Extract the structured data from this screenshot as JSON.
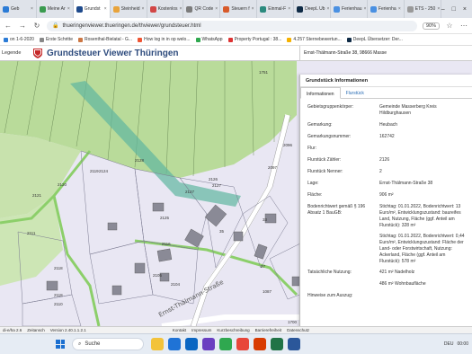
{
  "browser": {
    "tabs": [
      {
        "label": "Geb",
        "color": "#2b7bd6"
      },
      {
        "label": "Meine Ar",
        "color": "#3a9b4f"
      },
      {
        "label": "Grundst",
        "color": "#1e4a8c",
        "active": true
      },
      {
        "label": "Steinheid",
        "color": "#e8a33b"
      },
      {
        "label": "Kostenlos",
        "color": "#d24646"
      },
      {
        "label": "QR Code",
        "color": "#7c7c7c"
      },
      {
        "label": "Steuern f",
        "color": "#d85a2a"
      },
      {
        "label": "Einmal-F",
        "color": "#2b8a7e"
      },
      {
        "label": "DeepL Ub",
        "color": "#0f2b46"
      },
      {
        "label": "Ferienhau",
        "color": "#4a90e2"
      },
      {
        "label": "Ferienha",
        "color": "#4a90e2"
      },
      {
        "label": "ETS - 250",
        "color": "#999999"
      }
    ],
    "url": "thueringenviewer.thueringen.de/thviewer/grundsteuer.html",
    "zoom": "90%",
    "bookmarks": [
      "on 1-6-2020",
      "Erste Schritte",
      "Rosenthal-Bielatal - G...",
      "How log in in op welo...",
      "WhatsApp",
      "Property Portugal : 38...",
      "4.257 Sternebewertun...",
      "DeepL Übersetzer: Der..."
    ]
  },
  "app": {
    "legend_label": "Legende",
    "title": "Grundsteuer Viewer Thüringen",
    "search_address": "Ernst-Thälmann-Straße 38, 98666 Masse"
  },
  "map": {
    "parcel_labels": [
      "1751",
      "2121",
      "2120",
      "2119",
      "2118",
      "2124",
      "2128",
      "2127",
      "2126",
      "2125",
      "2111",
      "2116",
      "2105",
      "2104",
      "2118",
      "2110",
      "1700",
      "2052",
      "35",
      "33",
      "27",
      "1087",
      "2096",
      "2097",
      "2127"
    ],
    "street_label": "Ernst-Thälmann-Straße"
  },
  "panel": {
    "title": "Grundstück Informationen",
    "tabs": [
      "Informationen",
      "Flurstück"
    ],
    "rows": [
      {
        "key": "Gebietsgruppenkörper:",
        "value": "Gemeinde Masserberg Kreis Hildburghausen"
      },
      {
        "key": "Gemarkung:",
        "value": "Heubach"
      },
      {
        "key": "Gemarkungsnummer:",
        "value": "162742"
      },
      {
        "key": "Flur:",
        "value": ""
      },
      {
        "key": "Flurstück Zähler:",
        "value": "2126"
      },
      {
        "key": "Flurstück Nenner:",
        "value": "2"
      },
      {
        "key": "Lage:",
        "value": "Ernst-Thälmann-Straße 38"
      },
      {
        "key": "Fläche:",
        "value": "906 m²"
      },
      {
        "key": "Bodenrichtwert gemäß § 196 Absatz 1 BauGB:",
        "value": "Stichtag: 01.01.2022, Bodenrichtwert: 13 Euro/m², Entwicklungszustand: baureifes Land, Nutzung, Fläche (ggf. Anteil am Flurstück): 328 m²"
      },
      {
        "key": "",
        "value": "Stichtag: 01.01.2022, Bodenrichtwert: 0,44 Euro/m², Entwicklungszustand: Fläche der Land- oder Forstwirtschaft, Nutzung: Ackerland, Fläche (ggf. Anteil am Flurstück): 578 m²"
      },
      {
        "key": "Tatsächliche Nutzung:",
        "value": "421 m² Nadelholz"
      },
      {
        "key": "",
        "value": "486 m² Wohnbaufläche"
      },
      {
        "key": "Hinweise zum Auszug:",
        "value": ""
      }
    ]
  },
  "statusbar": [
    "di-e/ha 2.6",
    "Zeitansch",
    "Version 2.40.1.1.2.1",
    "Kontakt",
    "Impressum",
    "Kurzbeschreibung",
    "Barrierefreiheit",
    "Datenschutz"
  ],
  "taskbar": {
    "search_placeholder": "Suche",
    "tray": [
      "DEU",
      "00:00"
    ]
  }
}
